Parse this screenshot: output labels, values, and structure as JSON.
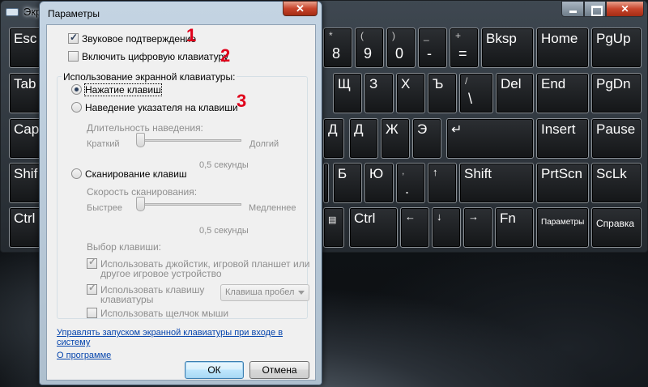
{
  "osk": {
    "title": "Экра",
    "keys": {
      "esc": "Esc",
      "tab": "Tab",
      "caps": "Cap",
      "shift_left": "Shif",
      "ctrl_left": "Ctrl",
      "k8_top": "*",
      "k8": "8",
      "k9_top": "(",
      "k9": "9",
      "k0_top": ")",
      "k0": "0",
      "minus_top": "_",
      "minus": "-",
      "plus_top": "+",
      "equals": "=",
      "bksp": "Bksp",
      "home": "Home",
      "pgup": "PgUp",
      "shch": "Щ",
      "z": "З",
      "kh": "Х",
      "hard": "Ъ",
      "slash_top": "/",
      "backslash": "\\",
      "del": "Del",
      "end": "End",
      "pgdn": "PgDn",
      "d": "Д",
      "zh": "Ж",
      "e": "Э",
      "l_partial": "Д",
      "insert": "Insert",
      "pause": "Pause",
      "b": "Б",
      "yu": "Ю",
      "comma": ",",
      "period": ".",
      "arrow_up": "↑",
      "shift_right": "Shift",
      "prtscn": "PrtScn",
      "sclk": "ScLk",
      "ctrl_right": "Ctrl",
      "arrow_left": "←",
      "arrow_down": "↓",
      "arrow_right": "→",
      "fn": "Fn",
      "options": "Параметры",
      "help": "Справка"
    }
  },
  "dialog": {
    "title": "Параметры",
    "sound_confirmation": "Звуковое подтверждение",
    "numeric_keypad": "Включить цифровую клавиатуру",
    "usage_group_label": "Использование экранной клавиатуры:",
    "click_keys": "Нажатие клавиш",
    "hover_keys": "Наведение указателя на клавиши",
    "hover_duration_label": "Длительность наведения:",
    "hover_short": "Краткий",
    "hover_long": "Долгий",
    "hover_value": "0,5 секунды",
    "scan_keys": "Сканирование клавиш",
    "scan_speed_label": "Скорость сканирования:",
    "scan_fast": "Быстрее",
    "scan_slow": "Медленнее",
    "scan_value": "0,5 секунды",
    "key_select_label": "Выбор клавиши:",
    "use_joystick_line1": "Использовать джойстик, игровой планшет или",
    "use_joystick_line2": "другое игровое устройство",
    "use_key_line1": "Использовать клавишу",
    "use_key_line2": "клавиатуры",
    "key_combo_value": "Клавиша пробел",
    "use_mouse_click": "Использовать щелчок мыши",
    "startup_link_line1": "Управлять запуском экранной клавиатуры при входе в",
    "startup_link_line2": "систему",
    "about_link": "О программе",
    "ok": "ОК",
    "cancel": "Отмена"
  },
  "markers": {
    "m1": "1",
    "m2": "2",
    "m3": "3"
  },
  "colors": {
    "marker": "#e0001b",
    "link": "#0645ad",
    "dialog_frame": "#c4d4e3"
  }
}
